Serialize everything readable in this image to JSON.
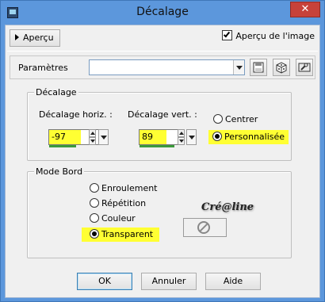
{
  "window": {
    "title": "Décalage",
    "close_label": "✕"
  },
  "toolbar": {
    "apercu_label": "Aperçu",
    "apercu_image_label": "Aperçu de l'image",
    "apercu_image_checked": true
  },
  "params": {
    "label": "Paramètres",
    "preset_value": ""
  },
  "decalage": {
    "group_title": "Décalage",
    "horiz_label": "Décalage horiz. :",
    "horiz_value": "-97",
    "vert_label": "Décalage vert. :",
    "vert_value": "89",
    "centre_label": "Centrer",
    "perso_label": "Personnalisée",
    "selected": "Personnalisée"
  },
  "mode_bord": {
    "group_title": "Mode Bord",
    "options": [
      "Enroulement",
      "Répétition",
      "Couleur",
      "Transparent"
    ],
    "selected": "Transparent"
  },
  "watermark": "Cré@line",
  "buttons": {
    "ok": "OK",
    "cancel": "Annuler",
    "help": "Aide"
  },
  "colors": {
    "highlight": "#ffff33",
    "title_bar": "#5c97dc",
    "close": "#c7423a"
  }
}
